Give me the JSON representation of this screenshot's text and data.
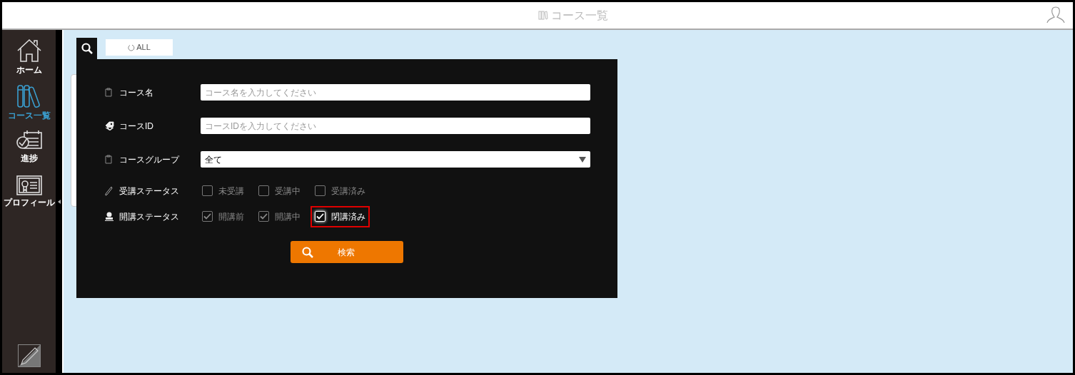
{
  "header": {
    "title": "コース一覧"
  },
  "sidebar": {
    "items": [
      {
        "kind": "home",
        "label": "ホーム",
        "selected": false
      },
      {
        "kind": "books",
        "label": "コース一覧",
        "selected": true
      },
      {
        "kind": "calendar",
        "label": "進捗",
        "selected": false
      },
      {
        "kind": "profile",
        "label": "プロフィール",
        "selected": false
      }
    ]
  },
  "search_panel": {
    "all_button": "ALL",
    "fields": [
      {
        "kind": "text",
        "label": "コース名",
        "placeholder": "コース名を入力してください"
      },
      {
        "kind": "text",
        "label": "コースID",
        "placeholder": "コースIDを入力してください"
      },
      {
        "kind": "select",
        "label": "コースグループ",
        "value": "全て"
      }
    ],
    "status_groups": [
      {
        "label": "受講ステータス",
        "options": [
          {
            "label": "未受講",
            "checked": false,
            "highlighted": false
          },
          {
            "label": "受講中",
            "checked": false,
            "highlighted": false
          },
          {
            "label": "受講済み",
            "checked": false,
            "highlighted": false
          }
        ]
      },
      {
        "label": "開講ステータス",
        "options": [
          {
            "label": "開講前",
            "checked": true,
            "highlighted": false
          },
          {
            "label": "開講中",
            "checked": true,
            "highlighted": false
          },
          {
            "label": "閉講済み",
            "checked": true,
            "highlighted": true
          }
        ]
      }
    ],
    "search_button": "検索"
  }
}
